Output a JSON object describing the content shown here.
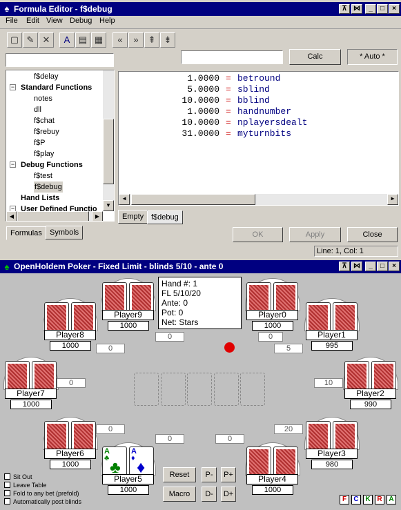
{
  "editor": {
    "title": "Formula Editor - f$debug",
    "menu": [
      "File",
      "Edit",
      "View",
      "Debug",
      "Help"
    ],
    "toolbar_icons": [
      "new-icon",
      "edit-icon",
      "delete-icon",
      "font-icon",
      "settings-icon",
      "grid-icon",
      "shift-left-icon",
      "shift-right-icon",
      "sort-up-icon",
      "sort-down-icon"
    ],
    "calc_label": "Calc",
    "auto_label": "* Auto *",
    "tree": [
      {
        "label": "f$delay",
        "indent": 2
      },
      {
        "label": "Standard Functions",
        "indent": 1,
        "bold": true,
        "toggle": "−"
      },
      {
        "label": "notes",
        "indent": 2
      },
      {
        "label": "dll",
        "indent": 2
      },
      {
        "label": "f$chat",
        "indent": 2
      },
      {
        "label": "f$rebuy",
        "indent": 2
      },
      {
        "label": "f$P",
        "indent": 2
      },
      {
        "label": "f$play",
        "indent": 2
      },
      {
        "label": "Debug Functions",
        "indent": 1,
        "bold": true,
        "toggle": "−"
      },
      {
        "label": "f$test",
        "indent": 2
      },
      {
        "label": "f$debug",
        "indent": 2,
        "selected": true
      },
      {
        "label": "Hand Lists",
        "indent": 1,
        "bold": true
      },
      {
        "label": "User Defined Functio",
        "indent": 1,
        "bold": true,
        "toggle": "−"
      }
    ],
    "lines": [
      {
        "value": "1.0000",
        "name": "betround"
      },
      {
        "value": "5.0000",
        "name": "sblind"
      },
      {
        "value": "10.0000",
        "name": "bblind"
      },
      {
        "value": "1.0000",
        "name": "handnumber"
      },
      {
        "value": "10.0000",
        "name": "nplayersdealt"
      },
      {
        "value": "31.0000",
        "name": "myturnbits"
      }
    ],
    "equals": "=",
    "bottom_tabs": [
      "Formulas",
      "Symbols"
    ],
    "editor_tabs": [
      "Empty",
      "f$debug"
    ],
    "ok_label": "OK",
    "apply_label": "Apply",
    "close_label": "Close",
    "status": "Line: 1, Col: 1"
  },
  "poker": {
    "title": "OpenHoldem Poker - Fixed Limit - blinds 5/10 - ante 0",
    "info": [
      "Hand #: 1",
      "FL 5/10/20",
      "Ante: 0",
      "Pot: 0",
      "Net: Stars"
    ],
    "players": [
      {
        "name": "Player0",
        "balance": "1000",
        "bet": "0"
      },
      {
        "name": "Player1",
        "balance": "995",
        "bet": "5"
      },
      {
        "name": "Player2",
        "balance": "990",
        "bet": "10"
      },
      {
        "name": "Player3",
        "balance": "980",
        "bet": "20"
      },
      {
        "name": "Player4",
        "balance": "1000",
        "bet": "0"
      },
      {
        "name": "Player5",
        "balance": "1000",
        "bet": "0"
      },
      {
        "name": "Player6",
        "balance": "1000",
        "bet": "0"
      },
      {
        "name": "Player7",
        "balance": "1000",
        "bet": "0"
      },
      {
        "name": "Player8",
        "balance": "1000",
        "bet": "0"
      },
      {
        "name": "Player9",
        "balance": "1000",
        "bet": "0"
      }
    ],
    "hero_cards": [
      {
        "rank": "A",
        "suit": "♣",
        "color": "#008000"
      },
      {
        "rank": "A",
        "suit": "♦",
        "color": "#0000cc"
      }
    ],
    "buttons": {
      "reset": "Reset",
      "macro": "Macro",
      "pminus": "P-",
      "pplus": "P+",
      "dminus": "D-",
      "dplus": "D+"
    },
    "checkboxes": [
      "Sit Out",
      "Leave Table",
      "Fold to any bet (prefold)",
      "Automatically post blinds"
    ],
    "mini": [
      {
        "label": "F",
        "color": "#cc0000"
      },
      {
        "label": "C",
        "color": "#0000cc"
      },
      {
        "label": "K",
        "color": "#008000"
      },
      {
        "label": "R",
        "color": "#cc0000"
      },
      {
        "label": "A",
        "color": "#008000"
      }
    ],
    "dealer_color": "#e00000"
  }
}
